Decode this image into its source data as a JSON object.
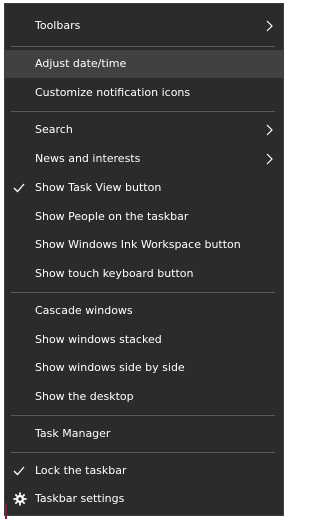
{
  "menu": {
    "toolbars": {
      "label": "Toolbars",
      "icon": "chevron-right-icon"
    },
    "adjust_date_time": {
      "label": "Adjust date/time"
    },
    "customize_notification_icons": {
      "label": "Customize notification icons"
    },
    "search": {
      "label": "Search",
      "icon": "chevron-right-icon"
    },
    "news_and_interests": {
      "label": "News and interests",
      "icon": "chevron-right-icon"
    },
    "show_task_view_button": {
      "label": "Show Task View button",
      "checked": true
    },
    "show_people": {
      "label": "Show People on the taskbar"
    },
    "show_ink_workspace": {
      "label": "Show Windows Ink Workspace button"
    },
    "show_touch_keyboard": {
      "label": "Show touch keyboard button"
    },
    "cascade_windows": {
      "label": "Cascade windows"
    },
    "show_windows_stacked": {
      "label": "Show windows stacked"
    },
    "show_windows_side_by_side": {
      "label": "Show windows side by side"
    },
    "show_the_desktop": {
      "label": "Show the desktop"
    },
    "task_manager": {
      "label": "Task Manager"
    },
    "lock_the_taskbar": {
      "label": "Lock the taskbar",
      "checked": true
    },
    "taskbar_settings": {
      "label": "Taskbar settings",
      "icon": "gear-icon"
    }
  },
  "colors": {
    "menu_background": "#2b2b2b",
    "hover_background": "#414141",
    "separator": "#5a5a5a",
    "text": "#ffffff"
  }
}
